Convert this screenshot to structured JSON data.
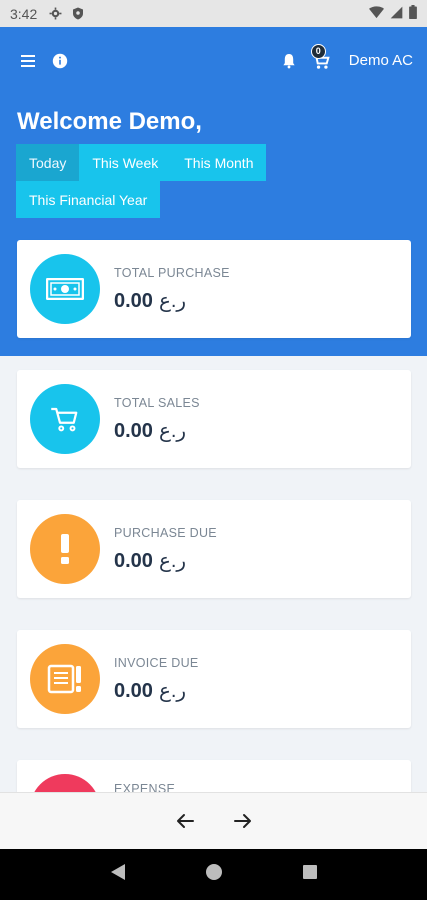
{
  "status_bar": {
    "time": "3:42"
  },
  "app_bar": {
    "account_label": "Demo AC",
    "cart_count": "0"
  },
  "hero": {
    "welcome": "Welcome Demo,",
    "filters": [
      "Today",
      "This Week",
      "This Month",
      "This Financial Year"
    ],
    "active_filter": "Today"
  },
  "cards": [
    {
      "label": "TOTAL PURCHASE",
      "amount": "0.00",
      "currency": "ر.ع",
      "color": "#18c4ec",
      "icon": "money-icon"
    },
    {
      "label": "TOTAL SALES",
      "amount": "0.00",
      "currency": "ر.ع",
      "color": "#18c4ec",
      "icon": "cart-icon"
    },
    {
      "label": "PURCHASE DUE",
      "amount": "0.00",
      "currency": "ر.ع",
      "color": "#fba43a",
      "icon": "exclamation-icon"
    },
    {
      "label": "INVOICE DUE",
      "amount": "0.00",
      "currency": "ر.ع",
      "color": "#fba43a",
      "icon": "invoice-alert-icon"
    },
    {
      "label": "EXPENSE",
      "amount": "",
      "currency": "",
      "color": "#ef3a5d",
      "icon": "expense-icon"
    }
  ]
}
